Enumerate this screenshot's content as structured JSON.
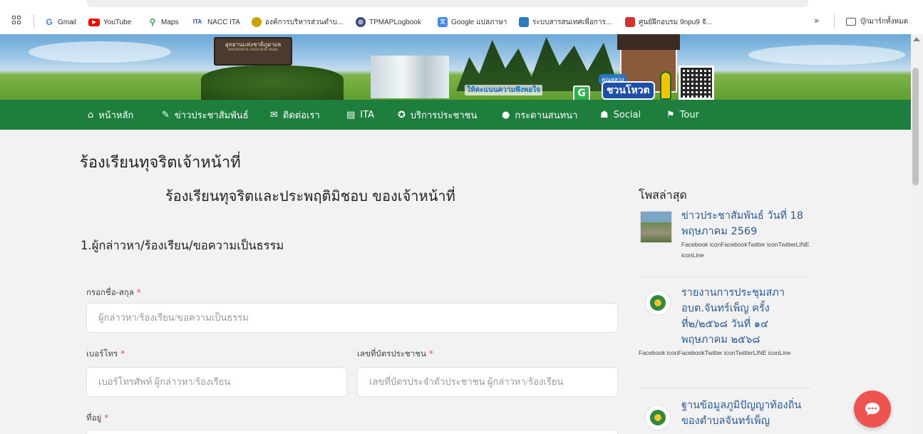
{
  "bookmarks": {
    "items": [
      {
        "label": "Gmail",
        "icon": "google-g-icon",
        "color": "#4285F4"
      },
      {
        "label": "YouTube",
        "icon": "youtube-icon",
        "color": "#FF0000"
      },
      {
        "label": "Maps",
        "icon": "maps-pin-icon",
        "color": "#34A853"
      },
      {
        "label": "NACC ITA",
        "icon": "ita-icon",
        "color": "#1f4e9e"
      },
      {
        "label": "องค์การบริหารส่วนตำบ...",
        "icon": "site-logo-icon",
        "color": "#c9a400"
      },
      {
        "label": "TPMAPLogbook",
        "icon": "globe-icon",
        "color": "#3c4a8a"
      },
      {
        "label": "Google แปลภาษา",
        "icon": "translate-icon",
        "color": "#4285F4"
      },
      {
        "label": "ระบบสารสนเทศเพื่อการ...",
        "icon": "system-icon",
        "color": "#2e7bbf"
      },
      {
        "label": "ศูนย์ฝึกอบรม 9npu9 จั...",
        "icon": "training-icon",
        "color": "#d1342c"
      }
    ],
    "more": "»",
    "all_bookmarks": "บุ๊กมาร์กทั้งหมด"
  },
  "banner": {
    "park_sign": "อุทยานแห่งชาติภูผายล",
    "park_sign_en": "PHUPHAYOL NATIONAL PARK",
    "slogan": "ให้คะแนนความพึงพอใจ",
    "g_badge": "G",
    "mascot_small": "คุณหลวง",
    "mascot_big": "ชวนโหวต"
  },
  "nav": {
    "items": [
      {
        "label": "หน้าหลัก",
        "icon": "home-icon"
      },
      {
        "label": "ข่าวประชาสัมพันธ์",
        "icon": "edit-icon"
      },
      {
        "label": "ติดต่อเรา",
        "icon": "envelope-icon"
      },
      {
        "label": "ITA",
        "icon": "list-icon"
      },
      {
        "label": "บริการประชาชน",
        "icon": "award-icon"
      },
      {
        "label": "กระดานสนทนา",
        "icon": "chat-bubble-icon"
      },
      {
        "label": "Social",
        "icon": "sitemap-icon"
      },
      {
        "label": "Tour",
        "icon": "flag-icon"
      }
    ]
  },
  "page": {
    "title": "ร้องเรียนทุจริตเจ้าหน้าที่",
    "form_title": "ร้องเรียนทุจริตและประพฤติมิชอบ ของเจ้าหน้าที่",
    "section_title": "1.ผู้กล่าวหา/ร้องเรียน/ขอความเป็นธรรม",
    "required_mark": "*"
  },
  "form": {
    "fullname": {
      "label": "กรอกชื่อ-สกุล",
      "placeholder": "ผู้กล่าวหา/ร้องเรียน/ขอความเป็นธรรม",
      "value": ""
    },
    "phone": {
      "label": "เบอร์โทร",
      "placeholder": "เบอร์โทรศัพท์ ผู้กล่าวหา/ร้องเรียน",
      "value": ""
    },
    "id_card": {
      "label": "เลขที่บัตรประชาชน",
      "placeholder": "เลขที่บัตรประจำตัวประชาชน ผู้กล่าวหา/ร้องเรียน",
      "value": ""
    },
    "address": {
      "label": "ที่อยู่"
    }
  },
  "sidebar": {
    "heading": "โพสล่าสุด",
    "posts": [
      {
        "title": "ข่าวประชาสัมพันธ์ วันที่ 18 พฤษภาคม 2569",
        "meta": "Facebook iconFacebookTwitter iconTwitterLINE iconLine"
      },
      {
        "title": "รายงานการประชุมสภา อบต.จันทร์เพ็ญ ครั้งที่๒/๒๕๖๘ วันที่ ๑๔ พฤษภาคม ๒๕๖๘",
        "meta": "Facebook iconFacebookTwitter iconTwitterLINE iconLine"
      },
      {
        "title": "ฐานข้อมูลภูมิปัญญาท้องถิ่น ของตำบลจันทร์เพ็ญ",
        "meta": ""
      }
    ]
  },
  "colors": {
    "nav_bg": "#1e7e3d",
    "link": "#2a5a9b",
    "chat_button": "#ef5350",
    "required": "#e04848"
  }
}
